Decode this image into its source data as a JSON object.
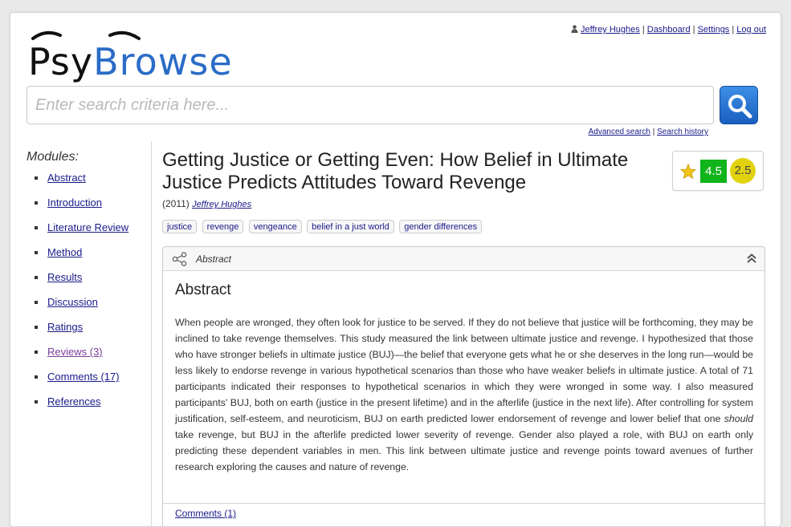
{
  "logo": {
    "part1": "Psy",
    "part2": "Browse"
  },
  "user": {
    "name": "Jeffrey Hughes",
    "links": [
      "Dashboard",
      "Settings",
      "Log out"
    ],
    "separator": "|"
  },
  "search": {
    "placeholder": "Enter search criteria here...",
    "value": "",
    "advanced": "Advanced search",
    "history": "Search history",
    "separator": "|"
  },
  "sidebar": {
    "title": "Modules:",
    "items": [
      {
        "label": "Abstract"
      },
      {
        "label": "Introduction"
      },
      {
        "label": "Literature Review"
      },
      {
        "label": "Method"
      },
      {
        "label": "Results"
      },
      {
        "label": "Discussion"
      },
      {
        "label": "Ratings"
      },
      {
        "label": "Reviews (3)"
      },
      {
        "label": "Comments (17)"
      },
      {
        "label": "References"
      }
    ]
  },
  "paper": {
    "title": "Getting Justice or Getting Even: How Belief in Ultimate Justice Predicts Attitudes Toward Revenge",
    "year": "(2011)",
    "author": "Jeffrey Hughes",
    "tags": [
      "justice",
      "revenge",
      "vengeance",
      "belief in a just world",
      "gender differences"
    ],
    "rating_primary": "4.5",
    "rating_secondary": "2.5"
  },
  "abstract_panel": {
    "header_label": "Abstract",
    "heading": "Abstract",
    "text_part1": "When people are wronged, they often look for justice to be served. If they do not believe that justice will be forthcoming, they may be inclined to take revenge themselves. This study measured the link between ultimate justice and revenge. I hypothesized that those who have stronger beliefs in ultimate justice (BUJ)—the belief that everyone gets what he or she deserves in the long run—would be less likely to endorse revenge in various hypothetical scenarios than those who have weaker beliefs in ultimate justice. A total of 71 participants indicated their responses to hypothetical scenarios in which they were wronged in some way. I also measured participants' BUJ, both on earth (justice in the present lifetime) and in the afterlife (justice in the next life). After controlling for system justification, self-esteem, and neuroticism, BUJ on earth predicted lower endorsement of revenge and lower belief that one ",
    "text_emph": "should",
    "text_part2": " take revenge, but BUJ in the afterlife predicted lower severity of revenge. Gender also played a role, with BUJ on earth only predicting these dependent variables in men. This link between ultimate justice and revenge points toward avenues of further research exploring the causes and nature of revenge.",
    "footer_link": "Comments (1)"
  },
  "colors": {
    "link": "#1a1a8a",
    "visited": "#7a3c9a",
    "brand_blue": "#2a6cc7",
    "rating_green": "#11b41b",
    "rating_yellow": "#e2d20e"
  },
  "icons": [
    "user-icon",
    "search-icon",
    "star-icon",
    "share-icon",
    "collapse-icon"
  ]
}
